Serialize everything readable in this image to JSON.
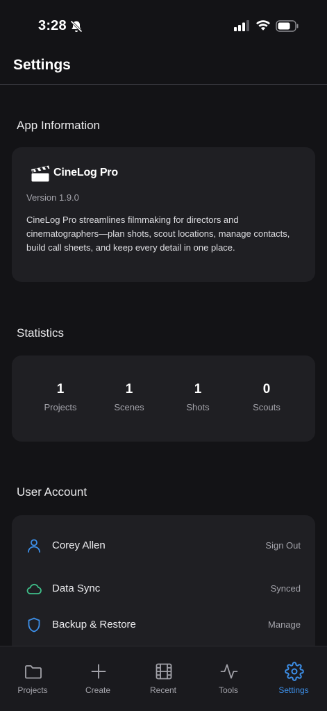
{
  "status_bar": {
    "time": "3:28"
  },
  "header": {
    "title": "Settings"
  },
  "app_info": {
    "section_title": "App Information",
    "app_name": "CineLog Pro",
    "version": "Version 1.9.0",
    "description": "CineLog Pro streamlines filmmaking for directors and cinematographers—plan shots, scout locations, manage contacts, build call sheets, and keep every detail in one place."
  },
  "statistics": {
    "section_title": "Statistics",
    "items": [
      {
        "value": "1",
        "label": "Projects"
      },
      {
        "value": "1",
        "label": "Scenes"
      },
      {
        "value": "1",
        "label": "Shots"
      },
      {
        "value": "0",
        "label": "Scouts"
      }
    ]
  },
  "user_account": {
    "section_title": "User Account",
    "rows": [
      {
        "icon": "person-icon",
        "label": "Corey Allen",
        "action": "Sign Out"
      },
      {
        "icon": "cloud-icon",
        "label": "Data Sync",
        "action": "Synced"
      },
      {
        "icon": "shield-icon",
        "label": "Backup & Restore",
        "action": "Manage"
      }
    ]
  },
  "tab_bar": {
    "active": "Settings",
    "accent_color": "#3d8fe8",
    "tabs": [
      {
        "icon": "folder-icon",
        "label": "Projects"
      },
      {
        "icon": "plus-icon",
        "label": "Create"
      },
      {
        "icon": "film-icon",
        "label": "Recent"
      },
      {
        "icon": "activity-icon",
        "label": "Tools"
      },
      {
        "icon": "gear-icon",
        "label": "Settings"
      }
    ]
  }
}
